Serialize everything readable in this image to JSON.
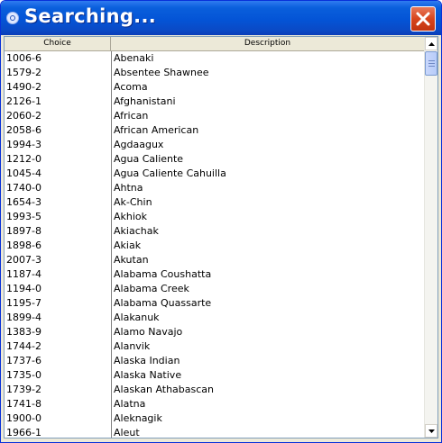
{
  "window": {
    "title": "Searching..."
  },
  "table": {
    "columns": [
      "Choice",
      "Description"
    ],
    "rows": [
      {
        "code": "1006-6",
        "desc": "Abenaki"
      },
      {
        "code": "1579-2",
        "desc": "Absentee Shawnee"
      },
      {
        "code": "1490-2",
        "desc": "Acoma"
      },
      {
        "code": "2126-1",
        "desc": "Afghanistani"
      },
      {
        "code": "2060-2",
        "desc": "African"
      },
      {
        "code": "2058-6",
        "desc": "African American"
      },
      {
        "code": "1994-3",
        "desc": "Agdaagux"
      },
      {
        "code": "1212-0",
        "desc": "Agua Caliente"
      },
      {
        "code": "1045-4",
        "desc": "Agua Caliente Cahuilla"
      },
      {
        "code": "1740-0",
        "desc": "Ahtna"
      },
      {
        "code": "1654-3",
        "desc": "Ak-Chin"
      },
      {
        "code": "1993-5",
        "desc": "Akhiok"
      },
      {
        "code": "1897-8",
        "desc": "Akiachak"
      },
      {
        "code": "1898-6",
        "desc": "Akiak"
      },
      {
        "code": "2007-3",
        "desc": "Akutan"
      },
      {
        "code": "1187-4",
        "desc": "Alabama Coushatta"
      },
      {
        "code": "1194-0",
        "desc": "Alabama Creek"
      },
      {
        "code": "1195-7",
        "desc": "Alabama Quassarte"
      },
      {
        "code": "1899-4",
        "desc": "Alakanuk"
      },
      {
        "code": "1383-9",
        "desc": "Alamo Navajo"
      },
      {
        "code": "1744-2",
        "desc": "Alanvik"
      },
      {
        "code": "1737-6",
        "desc": "Alaska Indian"
      },
      {
        "code": "1735-0",
        "desc": "Alaska Native"
      },
      {
        "code": "1739-2",
        "desc": "Alaskan Athabascan"
      },
      {
        "code": "1741-8",
        "desc": "Alatna"
      },
      {
        "code": "1900-0",
        "desc": "Aleknagik"
      },
      {
        "code": "1966-1",
        "desc": "Aleut"
      }
    ]
  },
  "icons": {
    "app": "java-cup-icon",
    "close": "close-icon",
    "scroll_up": "arrow-up-icon",
    "scroll_down": "arrow-down-icon"
  },
  "colors": {
    "titlebar": "#0454d6",
    "close_button": "#d7451d",
    "scroll_thumb": "#c1d3fb"
  }
}
